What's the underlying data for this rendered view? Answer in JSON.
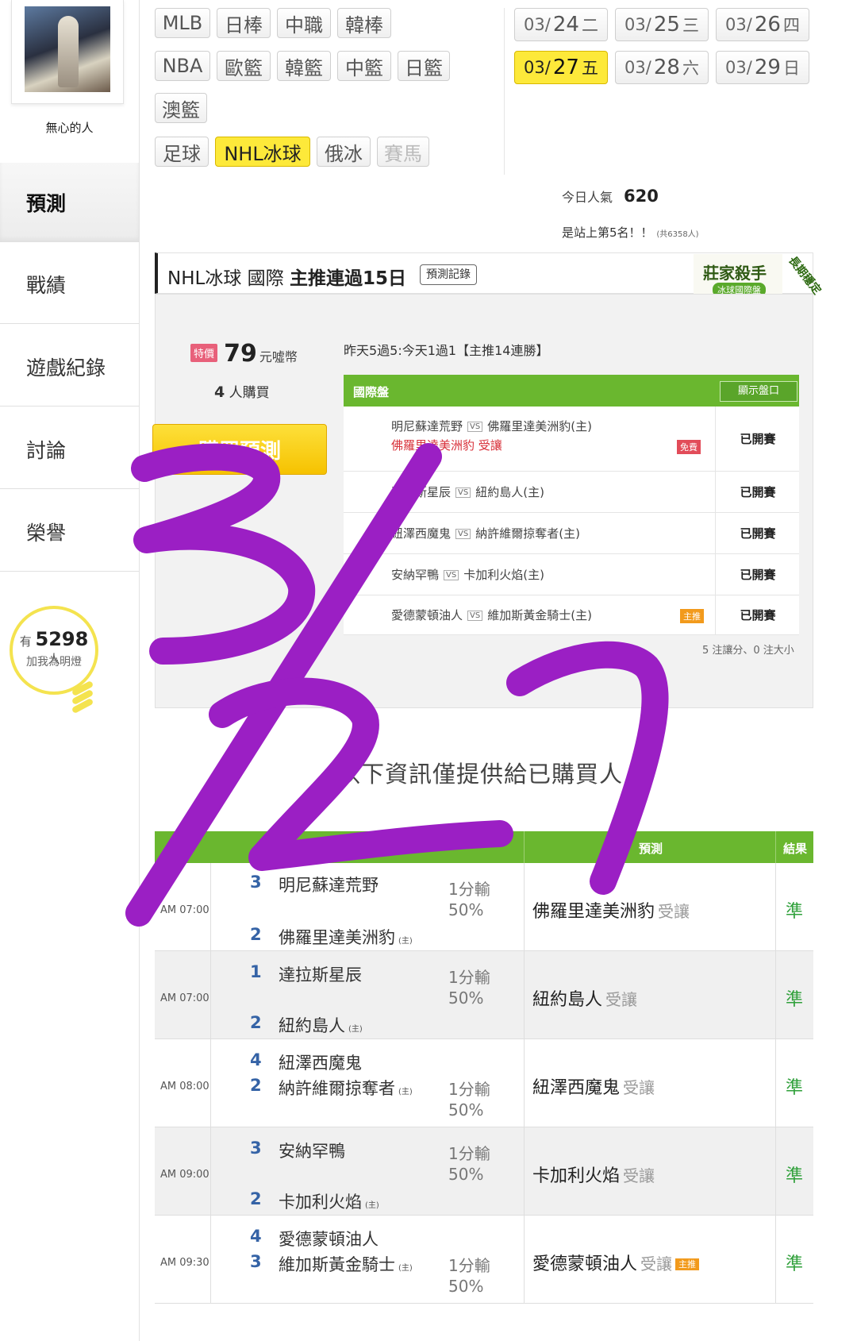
{
  "user": {
    "name": "無心的人"
  },
  "sidebar": {
    "items": [
      {
        "label": "預測",
        "active": true
      },
      {
        "label": "戰績"
      },
      {
        "label": "遊戲紀錄"
      },
      {
        "label": "討論"
      },
      {
        "label": "榮譽"
      }
    ],
    "lamp": {
      "prefix": "有",
      "count": "5298",
      "suffix": "人",
      "caption": "加我為明燈"
    }
  },
  "sports": {
    "row1": [
      "MLB",
      "日棒",
      "中職",
      "韓棒"
    ],
    "row2": [
      "NBA",
      "歐籃",
      "韓籃",
      "中籃",
      "日籃"
    ],
    "row3": [
      "澳籃"
    ],
    "row4": [
      "足球",
      "NHL冰球",
      "俄冰",
      "賽馬"
    ],
    "active": "NHL冰球"
  },
  "dates": [
    {
      "md": "03/",
      "d": "24",
      "w": "二"
    },
    {
      "md": "03/",
      "d": "25",
      "w": "三"
    },
    {
      "md": "03/",
      "d": "26",
      "w": "四"
    },
    {
      "md": "03/",
      "d": "27",
      "w": "五",
      "active": true
    },
    {
      "md": "03/",
      "d": "28",
      "w": "六"
    },
    {
      "md": "03/",
      "d": "29",
      "w": "日"
    }
  ],
  "stats": {
    "popularity_label": "今日人氣",
    "popularity": "620",
    "rank_text": "是站上第5名！！",
    "rank_total": "(共6358人)"
  },
  "title": {
    "text": "NHL冰球 國際 ",
    "bold": "主推連過15日",
    "record_button": "預測記錄"
  },
  "badge": {
    "title": "莊家殺手",
    "subtitle": "冰球國際盤",
    "ribbon": "長期穩定"
  },
  "offer": {
    "tag": "特價",
    "price": "79",
    "unit": "元噓幣",
    "buyers_count": "4",
    "buyers_label": "人購買",
    "buy_label": "購買預測",
    "summary": "昨天5過5:今天1過1【主推14連勝】"
  },
  "games_panel": {
    "header": "國際盤",
    "show_button": "顯示盤口",
    "vs": "VS",
    "rows": [
      {
        "away": "明尼蘇達荒野",
        "home": "佛羅里達美洲豹(主)",
        "pick": "佛羅里達美洲豹",
        "pick_type": "受讓",
        "tag": "免費",
        "status": "已開賽"
      },
      {
        "away": "達拉斯星辰",
        "home": "紐約島人(主)",
        "status": "已開賽"
      },
      {
        "away": "紐澤西魔鬼",
        "home": "納許維爾掠奪者(主)",
        "status": "已開賽"
      },
      {
        "away": "安納罕鴨",
        "home": "卡加利火焰(主)",
        "status": "已開賽"
      },
      {
        "away": "愛德蒙頓油人",
        "home": "維加斯黃金騎士(主)",
        "tag": "主推",
        "status": "已開賽"
      }
    ],
    "note": "5 注讓分、0 注大小"
  },
  "notice": "以下資訊僅提供給已購買人",
  "results": {
    "headers": {
      "prediction": "預測",
      "result": "結果"
    },
    "home_mark": "(主)",
    "rows": [
      {
        "time": "AM 07:00",
        "away": "明尼蘇達荒野",
        "away_score": "3",
        "home": "佛羅里達美洲豹",
        "home_score": "2",
        "spread": "1分輸",
        "pct": "50%",
        "pick": "佛羅里達美洲豹",
        "pick_type": "受讓",
        "result": "準"
      },
      {
        "time": "AM 07:00",
        "away": "達拉斯星辰",
        "away_score": "1",
        "home": "紐約島人",
        "home_score": "2",
        "spread": "1分輸",
        "pct": "50%",
        "pick": "紐約島人",
        "pick_type": "受讓",
        "result": "準"
      },
      {
        "time": "AM 08:00",
        "away": "紐澤西魔鬼",
        "away_score": "4",
        "home": "納許維爾掠奪者",
        "home_score": "2",
        "spread": "1分輸",
        "pct": "50%",
        "pick": "紐澤西魔鬼",
        "pick_type": "受讓",
        "result": "準"
      },
      {
        "time": "AM 09:00",
        "away": "安納罕鴨",
        "away_score": "3",
        "home": "卡加利火焰",
        "home_score": "2",
        "spread": "1分輸",
        "pct": "50%",
        "pick": "卡加利火焰",
        "pick_type": "受讓",
        "result": "準"
      },
      {
        "time": "AM 09:30",
        "away": "愛德蒙頓油人",
        "away_score": "4",
        "home": "維加斯黃金騎士",
        "home_score": "3",
        "spread": "1分輸",
        "pct": "50%",
        "pick": "愛德蒙頓油人",
        "pick_type": "受讓",
        "pick_tag": "主推",
        "result": "準"
      }
    ]
  },
  "annotation": {
    "text": "3/27",
    "color": "#9b1fc4"
  },
  "colors": {
    "green": "#6ab72f",
    "yellow": "#fde93a",
    "red": "#d8313a",
    "score_blue": "#3563a6",
    "hit_green": "#2fa03a"
  }
}
